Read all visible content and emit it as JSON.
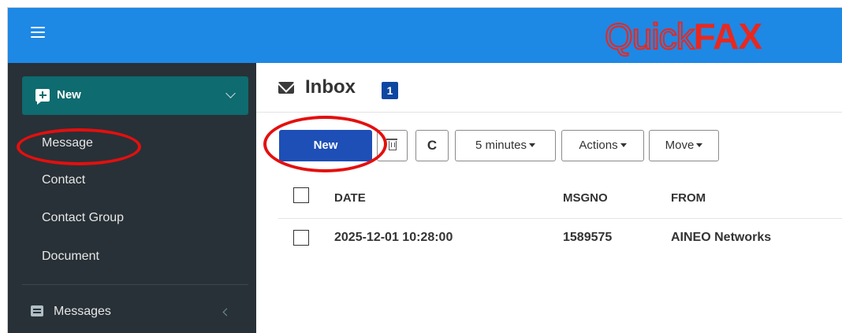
{
  "header": {
    "logo_quick": "Quick",
    "logo_fax": "FAX",
    "brand_color": "#1e88e5",
    "logo_accent": "#e8281f"
  },
  "sidebar": {
    "new_button_label": "New",
    "new_submenu": [
      "Message",
      "Contact",
      "Contact Group",
      "Document"
    ],
    "messages_label": "Messages",
    "background": "#283137",
    "new_button_color": "#0e6b6f"
  },
  "main": {
    "title": "Inbox",
    "unread_count": "1",
    "toolbar": {
      "new_label": "New",
      "refresh_label": "C",
      "interval_label": "5 minutes",
      "actions_label": "Actions",
      "move_label": "Move"
    },
    "table": {
      "columns": [
        "DATE",
        "MSGNO",
        "FROM"
      ],
      "rows": [
        {
          "date": "2025-12-01 10:28:00",
          "msgno": "1589575",
          "from": "AINEO Networks"
        }
      ]
    }
  },
  "annotation_color": "#e40f0f"
}
